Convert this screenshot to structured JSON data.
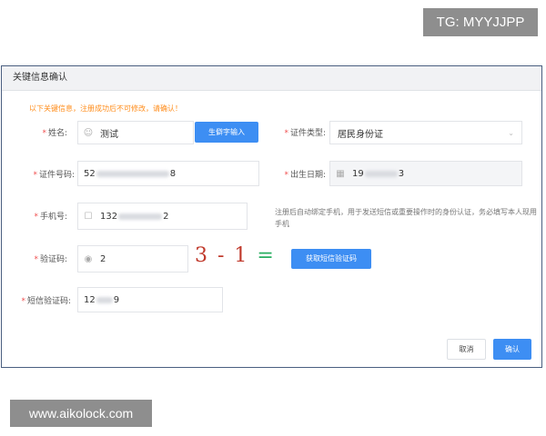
{
  "watermarks": {
    "tg": "TG: MYYJJPP",
    "site": "www.aikolock.com"
  },
  "dialog": {
    "title": "关键信息确认",
    "notice": "以下关键信息，注册成功后不可修改，请确认！",
    "required_mark": "*",
    "name": {
      "label": "姓名:",
      "value": "测试",
      "icon": "user-icon"
    },
    "rare_char_button": "生僻字输入",
    "id_type": {
      "label": "证件类型:",
      "value": "居民身份证"
    },
    "id_number": {
      "label": "证件号码:",
      "prefix": "52",
      "suffix": "8"
    },
    "birth_date": {
      "label": "出生日期:",
      "prefix": "19",
      "suffix": "3",
      "icon": "calendar-icon"
    },
    "phone": {
      "label": "手机号:",
      "prefix": "132",
      "suffix": "2",
      "icon": "phone-icon"
    },
    "phone_helper": "注册后自动绑定手机，用于发送短信或重要操作时的身份认证，务必填写本人现用手机",
    "captcha": {
      "label": "验证码:",
      "value": "2",
      "image_text_a": "3 - 1",
      "image_text_b": "="
    },
    "sms_button": "获取短信验证码",
    "sms_code": {
      "label": "短信验证码:",
      "prefix": "12",
      "suffix": "9"
    },
    "cancel_button": "取消",
    "confirm_button": "确认"
  },
  "colors": {
    "accent": "#3d8ef3",
    "notice": "#ff8c1a",
    "required": "#f04e4e",
    "border": "#4a5f80"
  }
}
